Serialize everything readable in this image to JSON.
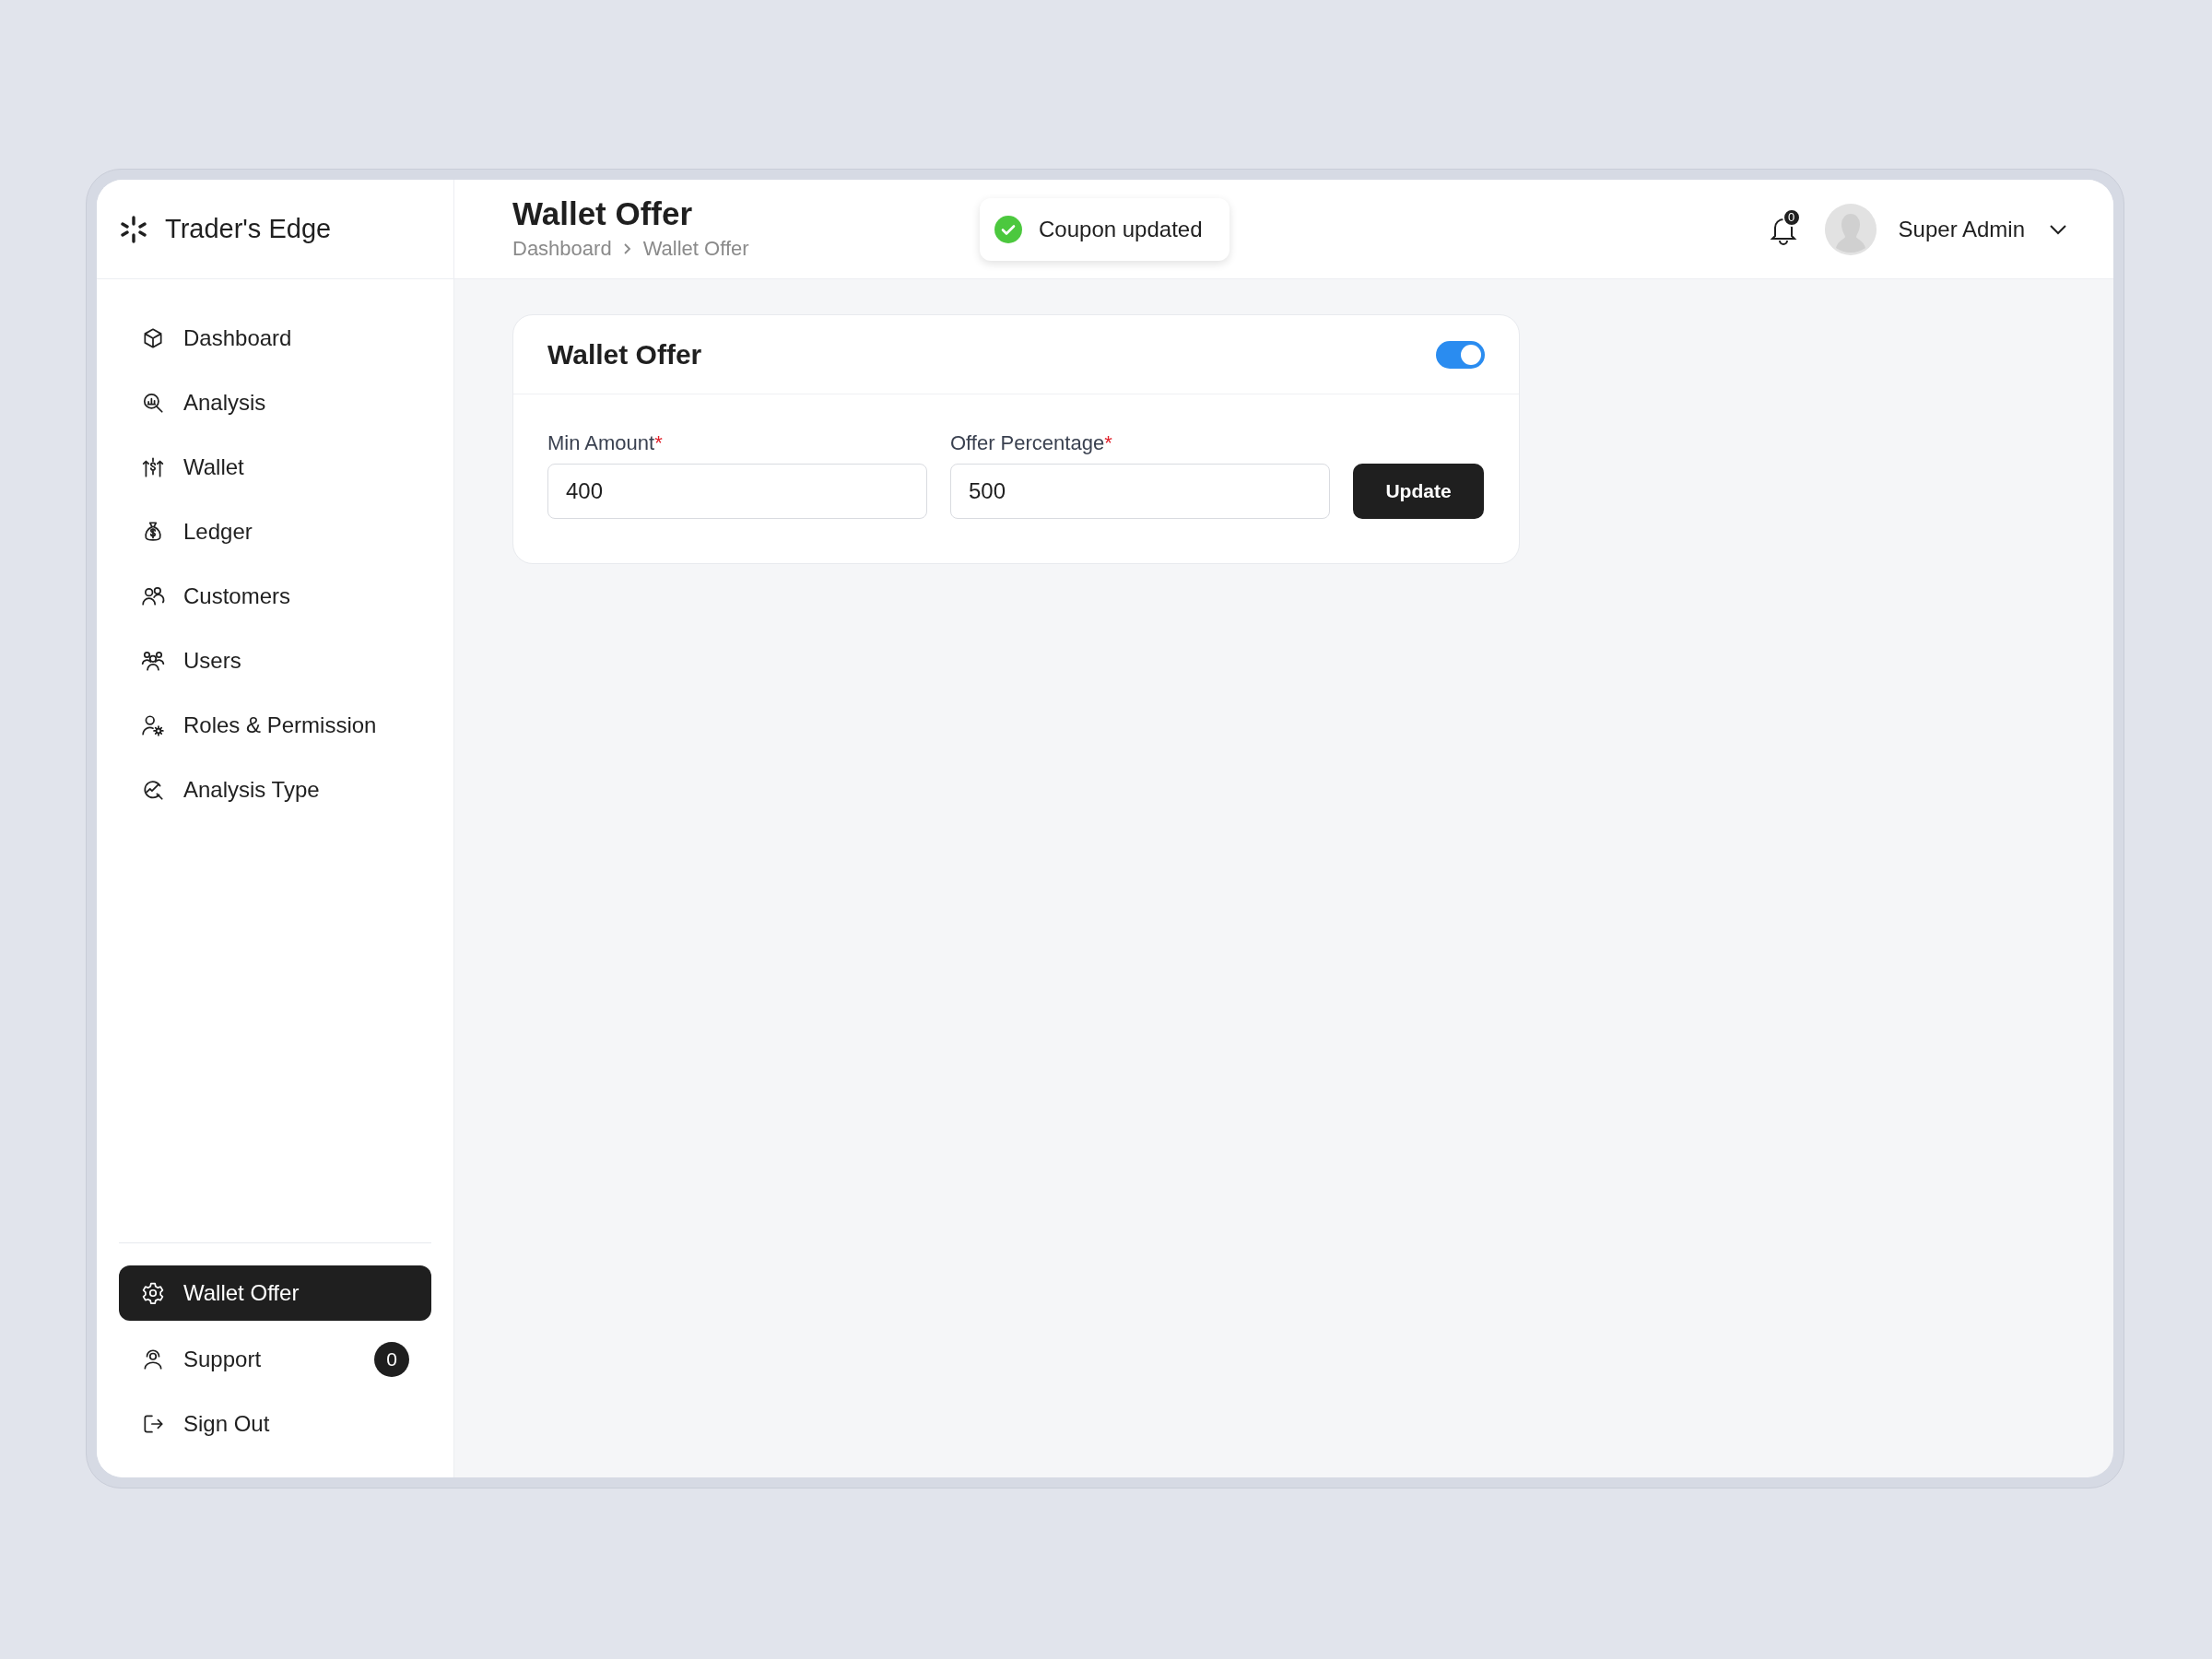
{
  "brand": {
    "name": "Trader's Edge"
  },
  "sidebar": {
    "items": [
      {
        "label": "Dashboard",
        "selected": false
      },
      {
        "label": "Analysis",
        "selected": false
      },
      {
        "label": "Wallet",
        "selected": false
      },
      {
        "label": "Ledger",
        "selected": false
      },
      {
        "label": "Customers",
        "selected": false
      },
      {
        "label": "Users",
        "selected": false
      },
      {
        "label": "Roles & Permission",
        "selected": false
      },
      {
        "label": "Analysis Type",
        "selected": false
      }
    ],
    "bottom_items": [
      {
        "label": "Wallet Offer",
        "selected": true
      },
      {
        "label": "Support",
        "selected": false,
        "badge": "0"
      },
      {
        "label": "Sign Out",
        "selected": false
      }
    ]
  },
  "header": {
    "title": "Wallet Offer",
    "breadcrumb": [
      "Dashboard",
      "Wallet Offer"
    ],
    "notification_count": "0",
    "user": "Super Admin"
  },
  "toast": {
    "message": "Coupon updated"
  },
  "card": {
    "title": "Wallet Offer",
    "enabled": true,
    "fields": [
      {
        "label": "Min Amount",
        "required": true,
        "required_mark": "*",
        "value": "400"
      },
      {
        "label": "Offer Percentage",
        "required": true,
        "required_mark": "*",
        "value": "500"
      }
    ],
    "button": "Update"
  }
}
